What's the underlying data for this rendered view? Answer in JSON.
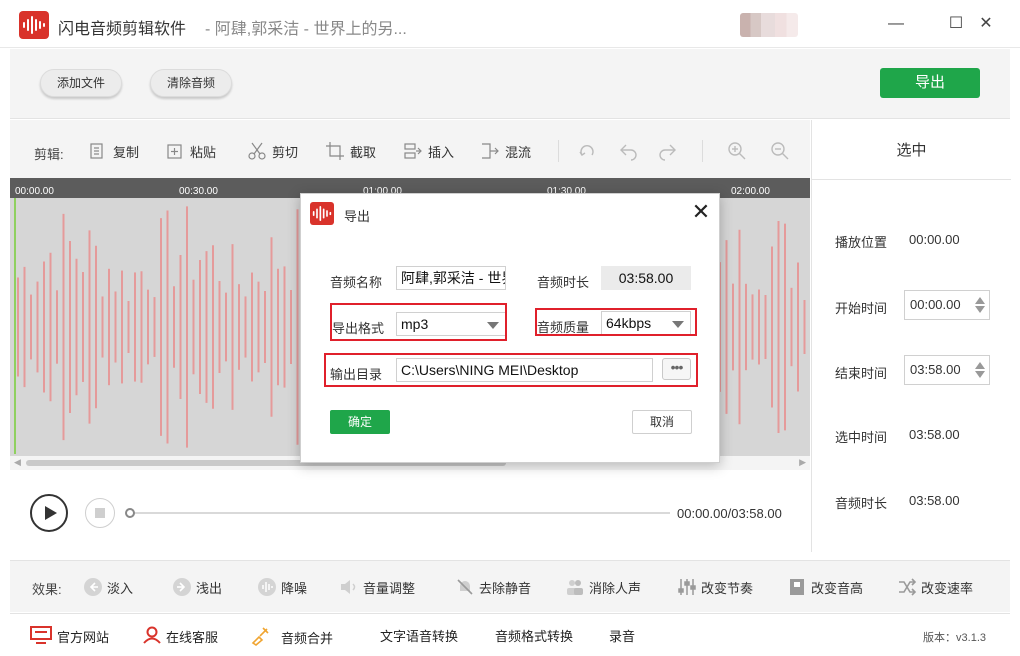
{
  "window": {
    "app_name": "闪电音频剪辑软件",
    "title_separator": " - ",
    "song_title": "阿肆,郭采洁 - 世界上的另...",
    "minimize": "—",
    "maximize": "☐",
    "close": "✕"
  },
  "toolbar": {
    "add_file": "添加文件",
    "clear_audio": "清除音频",
    "export": "导出"
  },
  "edit_bar": {
    "label": "剪辑:",
    "tools": [
      {
        "name": "copy",
        "label": "复制",
        "icon": "copy-icon"
      },
      {
        "name": "paste",
        "label": "粘贴",
        "icon": "paste-icon"
      },
      {
        "name": "cut",
        "label": "剪切",
        "icon": "scissors-icon"
      },
      {
        "name": "crop",
        "label": "截取",
        "icon": "crop-icon"
      },
      {
        "name": "insert",
        "label": "插入",
        "icon": "insert-icon"
      },
      {
        "name": "mix",
        "label": "混流",
        "icon": "mix-icon"
      }
    ]
  },
  "timeline": {
    "ticks": [
      "00:00.00",
      "00:30.00",
      "01:00.00",
      "01:30.00",
      "02:00.00"
    ]
  },
  "player": {
    "time": "00:00.00/03:58.00",
    "progress": 0
  },
  "right_panel": {
    "title": "选中",
    "play_position_label": "播放位置",
    "play_position": "00:00.00",
    "start_label": "开始时间",
    "start_value": "00:00.00",
    "end_label": "结束时间",
    "end_value": "03:58.00",
    "selection_label": "选中时间",
    "selection_value": "03:58.00",
    "duration_label": "音频时长",
    "duration_value": "03:58.00"
  },
  "effects": {
    "label": "效果:",
    "items": [
      {
        "label": "淡入",
        "icon": "fade-in-icon"
      },
      {
        "label": "浅出",
        "icon": "fade-out-icon"
      },
      {
        "label": "降噪",
        "icon": "denoise-icon"
      },
      {
        "label": "音量调整",
        "icon": "volume-icon"
      },
      {
        "label": "去除静音",
        "icon": "mute-icon"
      },
      {
        "label": "消除人声",
        "icon": "people-icon"
      },
      {
        "label": "改变节奏",
        "icon": "tempo-icon"
      },
      {
        "label": "改变音高",
        "icon": "pitch-icon"
      },
      {
        "label": "改变速率",
        "icon": "shuffle-icon"
      }
    ]
  },
  "bottom_bar": {
    "website": "官方网站",
    "service": "在线客服",
    "merge": "音频合并",
    "tts": "文字语音转换",
    "convert": "音频格式转换",
    "record": "录音",
    "version": "版本：v3.1.3"
  },
  "dialog": {
    "title": "导出",
    "name_label": "音频名称",
    "name_value": "阿肆,郭采洁 - 世界",
    "duration_label": "音频时长",
    "duration_value": "03:58.00",
    "format_label": "导出格式",
    "format_value": "mp3",
    "quality_label": "音频质量",
    "quality_value": "64kbps",
    "dir_label": "输出目录",
    "dir_value": "C:\\Users\\NING MEI\\Desktop",
    "more": "•••",
    "ok": "确定",
    "cancel": "取消"
  },
  "colors": {
    "accent_green": "#1fa64a",
    "brand_red": "#d9332b",
    "highlight_red": "#e0202b",
    "waveform": "#e59a9a",
    "cursor": "#8fd05f"
  }
}
